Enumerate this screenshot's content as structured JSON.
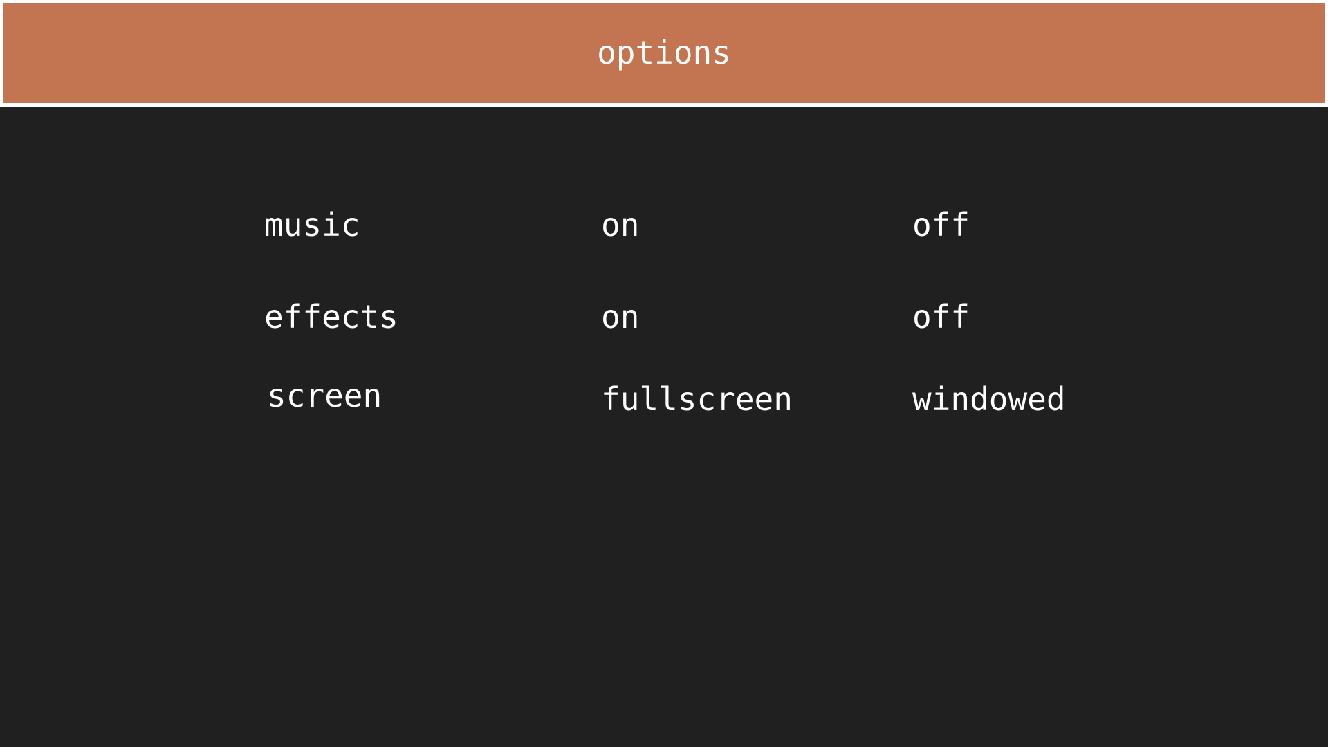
{
  "header": {
    "title": "options"
  },
  "settings": {
    "rows": [
      {
        "label": "music",
        "option_a": "on",
        "option_b": "off"
      },
      {
        "label": "effects",
        "option_a": "on",
        "option_b": "off"
      },
      {
        "label": "screen",
        "option_a": "fullscreen",
        "option_b": "windowed"
      }
    ]
  },
  "colors": {
    "header_background": "#c37551",
    "header_border": "#ffffff",
    "page_background": "#202020",
    "text": "#ffffff"
  }
}
